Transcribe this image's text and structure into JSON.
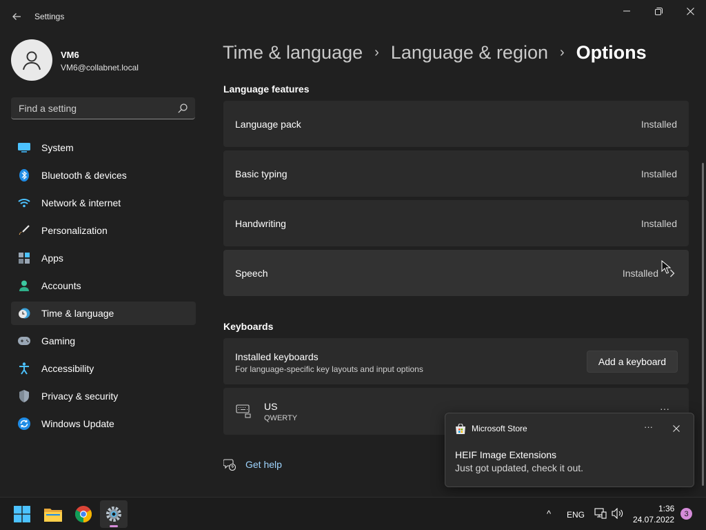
{
  "window": {
    "title": "Settings"
  },
  "profile": {
    "name": "VM6",
    "email": "VM6@collabnet.local"
  },
  "search": {
    "placeholder": "Find a setting"
  },
  "sidebar": {
    "items": [
      {
        "label": "System",
        "icon": "monitor-icon"
      },
      {
        "label": "Bluetooth & devices",
        "icon": "bluetooth-icon"
      },
      {
        "label": "Network & internet",
        "icon": "wifi-icon"
      },
      {
        "label": "Personalization",
        "icon": "brush-icon"
      },
      {
        "label": "Apps",
        "icon": "apps-icon"
      },
      {
        "label": "Accounts",
        "icon": "person-icon"
      },
      {
        "label": "Time & language",
        "icon": "clock-globe-icon",
        "active": true
      },
      {
        "label": "Gaming",
        "icon": "gamepad-icon"
      },
      {
        "label": "Accessibility",
        "icon": "accessibility-icon"
      },
      {
        "label": "Privacy & security",
        "icon": "shield-icon"
      },
      {
        "label": "Windows Update",
        "icon": "update-icon"
      }
    ],
    "accent": "#d58bd9"
  },
  "breadcrumb": {
    "items": [
      "Time & language",
      "Language & region"
    ],
    "current": "Options",
    "separator": "›"
  },
  "language_features": {
    "title": "Language features",
    "rows": [
      {
        "label": "Language pack",
        "status": "Installed"
      },
      {
        "label": "Basic typing",
        "status": "Installed"
      },
      {
        "label": "Handwriting",
        "status": "Installed"
      },
      {
        "label": "Speech",
        "status": "Installed"
      }
    ]
  },
  "keyboards": {
    "title": "Keyboards",
    "installed_title": "Installed keyboards",
    "installed_subtitle": "For language-specific key layouts and input options",
    "add_button": "Add a keyboard",
    "layout_name": "US",
    "layout_type": "QWERTY",
    "more": "···"
  },
  "help": {
    "label": "Get help"
  },
  "toast": {
    "app": "Microsoft Store",
    "more": "···",
    "title": "HEIF Image Extensions",
    "body": "Just got updated, check it out."
  },
  "taskbar": {
    "apps": [
      "start-icon",
      "file-explorer-icon",
      "chrome-icon",
      "settings-icon"
    ],
    "tray": {
      "chevron": "^",
      "lang": "ENG",
      "time": "1:36",
      "date": "24.07.2022",
      "notifications": "3"
    }
  }
}
